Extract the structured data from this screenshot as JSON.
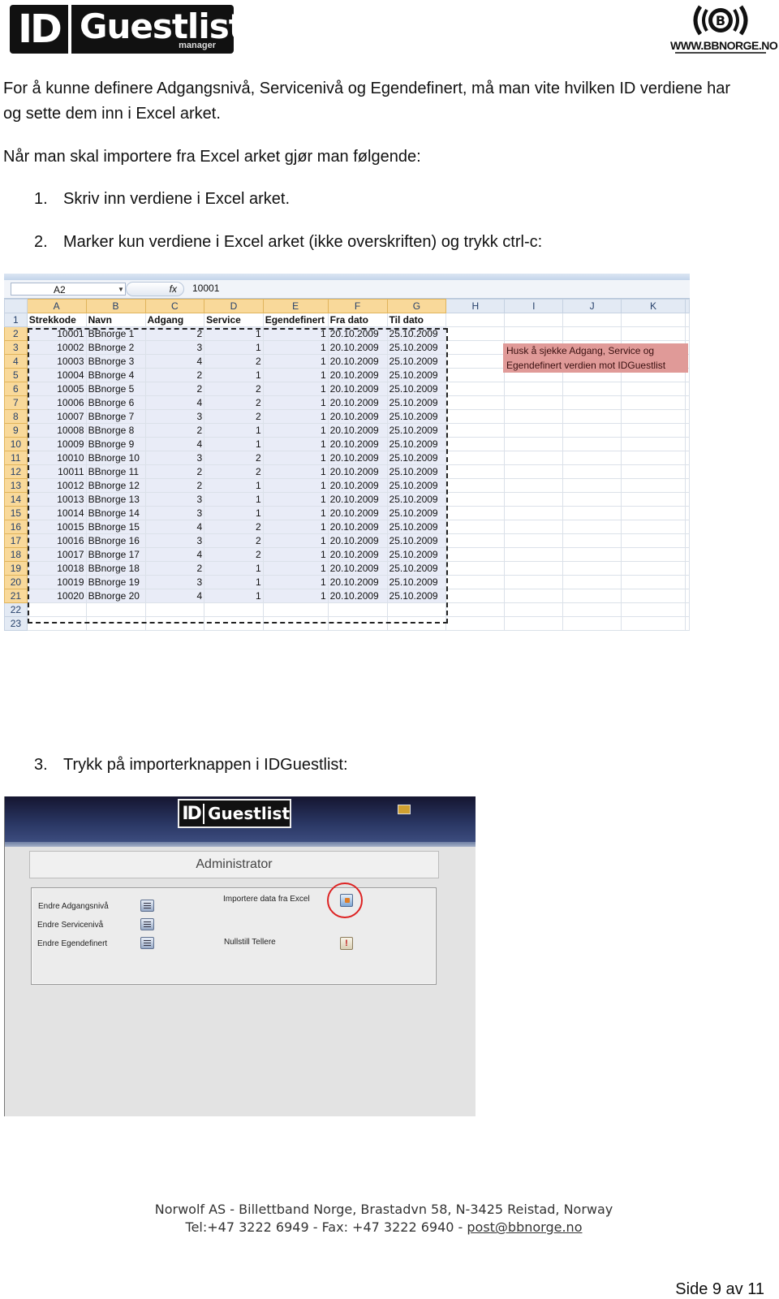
{
  "header": {
    "left_logo_id": "ID",
    "left_logo_word": "Guestlist",
    "left_logo_sub": "manager",
    "right_logo_url": "WWW.BBNORGE.NO"
  },
  "intro": {
    "p1_line1": "For å kunne definere Adgangsnivå, Servicenivå og Egendefinert, må man vite hvilken ID verdiene har",
    "p1_line2": "og sette dem inn i Excel arket.",
    "p2": "Når man skal importere fra Excel arket gjør man følgende:"
  },
  "steps": [
    {
      "num": "1.",
      "text": "Skriv inn verdiene i Excel arket."
    },
    {
      "num": "2.",
      "text": "Marker kun verdiene i Excel arket (ikke overskriften) og trykk ctrl-c:"
    },
    {
      "num": "3.",
      "text": "Trykk på importerknappen i IDGuestlist:"
    }
  ],
  "excel": {
    "name_box": "A2",
    "fx": "fx",
    "formula_value": "10001",
    "columns": [
      "A",
      "B",
      "C",
      "D",
      "E",
      "F",
      "G",
      "H",
      "I",
      "J",
      "K"
    ],
    "header_row": [
      "Strekkode",
      "Navn",
      "Adgang",
      "Service",
      "Egendefinert",
      "Fra dato",
      "Til dato"
    ],
    "rows": [
      [
        "10001",
        "BBnorge 1",
        "2",
        "1",
        "1",
        "20.10.2009",
        "25.10.2009"
      ],
      [
        "10002",
        "BBnorge 2",
        "3",
        "1",
        "1",
        "20.10.2009",
        "25.10.2009"
      ],
      [
        "10003",
        "BBnorge 3",
        "4",
        "2",
        "1",
        "20.10.2009",
        "25.10.2009"
      ],
      [
        "10004",
        "BBnorge 4",
        "2",
        "1",
        "1",
        "20.10.2009",
        "25.10.2009"
      ],
      [
        "10005",
        "BBnorge 5",
        "2",
        "2",
        "1",
        "20.10.2009",
        "25.10.2009"
      ],
      [
        "10006",
        "BBnorge 6",
        "4",
        "2",
        "1",
        "20.10.2009",
        "25.10.2009"
      ],
      [
        "10007",
        "BBnorge 7",
        "3",
        "2",
        "1",
        "20.10.2009",
        "25.10.2009"
      ],
      [
        "10008",
        "BBnorge 8",
        "2",
        "1",
        "1",
        "20.10.2009",
        "25.10.2009"
      ],
      [
        "10009",
        "BBnorge 9",
        "4",
        "1",
        "1",
        "20.10.2009",
        "25.10.2009"
      ],
      [
        "10010",
        "BBnorge 10",
        "3",
        "2",
        "1",
        "20.10.2009",
        "25.10.2009"
      ],
      [
        "10011",
        "BBnorge 11",
        "2",
        "2",
        "1",
        "20.10.2009",
        "25.10.2009"
      ],
      [
        "10012",
        "BBnorge 12",
        "2",
        "1",
        "1",
        "20.10.2009",
        "25.10.2009"
      ],
      [
        "10013",
        "BBnorge 13",
        "3",
        "1",
        "1",
        "20.10.2009",
        "25.10.2009"
      ],
      [
        "10014",
        "BBnorge 14",
        "3",
        "1",
        "1",
        "20.10.2009",
        "25.10.2009"
      ],
      [
        "10015",
        "BBnorge 15",
        "4",
        "2",
        "1",
        "20.10.2009",
        "25.10.2009"
      ],
      [
        "10016",
        "BBnorge 16",
        "3",
        "2",
        "1",
        "20.10.2009",
        "25.10.2009"
      ],
      [
        "10017",
        "BBnorge 17",
        "4",
        "2",
        "1",
        "20.10.2009",
        "25.10.2009"
      ],
      [
        "10018",
        "BBnorge 18",
        "2",
        "1",
        "1",
        "20.10.2009",
        "25.10.2009"
      ],
      [
        "10019",
        "BBnorge 19",
        "3",
        "1",
        "1",
        "20.10.2009",
        "25.10.2009"
      ],
      [
        "10020",
        "BBnorge 20",
        "4",
        "1",
        "1",
        "20.10.2009",
        "25.10.2009"
      ]
    ],
    "row_numbers": [
      "1",
      "2",
      "3",
      "4",
      "5",
      "6",
      "7",
      "8",
      "9",
      "10",
      "11",
      "12",
      "13",
      "14",
      "15",
      "16",
      "17",
      "18",
      "19",
      "20",
      "21",
      "22",
      "23"
    ],
    "note_line1": "Husk å sjekke Adgang, Service og",
    "note_line2": "Egendefinert verdien mot IDGuestlist"
  },
  "app": {
    "logo_id": "ID",
    "logo_word": "Guestlist",
    "title": "Administrator",
    "left_items": [
      "Endre Adgangsnivå",
      "Endre Servicenivå",
      "Endre Egendefinert"
    ],
    "import_label": "Importere data fra Excel",
    "reset_label": "Nullstill Tellere",
    "reset_glyph": "!"
  },
  "footer": {
    "line1": "Norwolf AS - Billettband Norge, Brastadvn 58, N-3425 Reistad, Norway",
    "line2_prefix": "Tel:+47 3222 6949 - Fax: +47 3222 6940 - ",
    "email": "post@bbnorge.no",
    "page": "Side 9 av 11"
  },
  "colors": {
    "selection_header": "#f9d99a",
    "note_bg": "#e09a98",
    "highlight_circle": "#dd2222",
    "app_topbar": "#2a3764"
  }
}
